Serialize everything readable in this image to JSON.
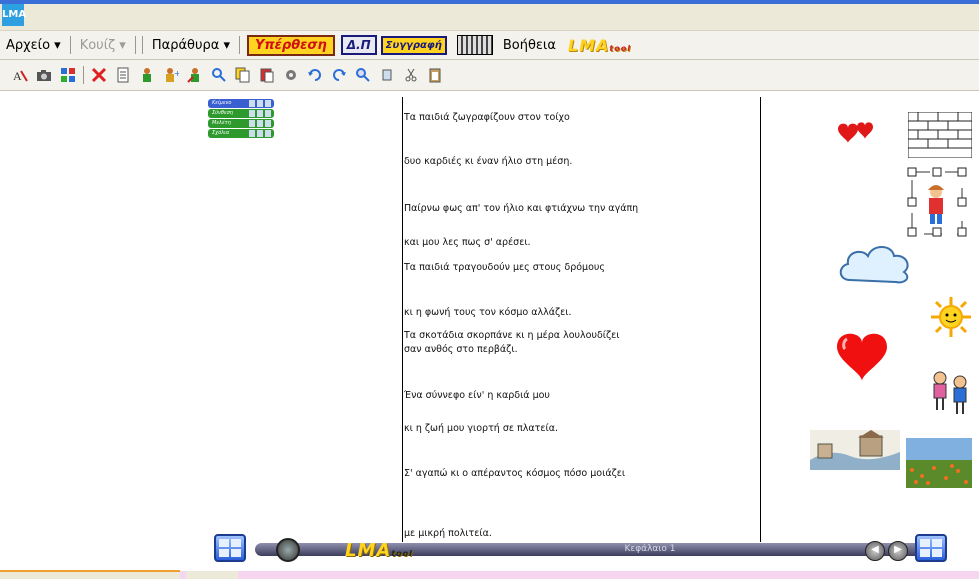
{
  "app": {
    "icon_label": "LMA"
  },
  "menu": {
    "items": [
      {
        "label": "Αρχείο ▾",
        "enabled": true
      },
      {
        "label": "Κουίζ ▾",
        "enabled": false
      },
      {
        "label": "Παράθυρα ▾",
        "enabled": true
      }
    ],
    "overview_button": "Υπέρθεση",
    "dp_button": "Δ.Π",
    "writing_button": "Συγγραφή",
    "help": "Βοήθεια",
    "logo_text": "LMA",
    "logo_sub": "tool"
  },
  "toolbar": {
    "icons": [
      "font-icon",
      "camera-icon",
      "grid-icon",
      "delete-icon",
      "page-icon",
      "person-icon",
      "person-add-icon",
      "person-edit-icon",
      "search-person-icon",
      "copy-icon",
      "paste-icon",
      "settings-icon",
      "undo-icon",
      "redo-icon",
      "zoom-icon",
      "small-page-icon",
      "scissors-icon",
      "clipboard-icon"
    ]
  },
  "mini_panel": {
    "rows": [
      {
        "label": "Κείμενο",
        "color": "#3a5fd0"
      },
      {
        "label": "Σύνθεση",
        "color": "#2e9a2e"
      },
      {
        "label": "Μελέτη",
        "color": "#2e9a2e"
      },
      {
        "label": "Σχόλια",
        "color": "#2e9a2e"
      }
    ]
  },
  "document": {
    "lines": [
      "Τα παιδιά ζωγραφίζουν στον τοίχο",
      "δυο καρδιές κι έναν ήλιο στη μέση.",
      "Παίρνω φως απ' τον ήλιο και φτιάχνω την αγάπη",
      "και μου λες πως σ' αρέσει.",
      "Τα παιδιά τραγουδούν μες στους δρόμους",
      "κι η φωνή τους τον κόσμο αλλάζει.",
      "Τα σκοτάδια σκορπάνε κι η μέρα λουλουδίζει",
      "σαν ανθός στο περβάζι.",
      "Ένα σύννεφο είν' η καρδιά μου",
      "κι η ζωή μου γιορτή σε πλατεία.",
      "Σ' αγαπώ κι ο απέραντος κόσμος πόσο μοιάζει",
      "με μικρή πολιτεία."
    ]
  },
  "clipart": {
    "items": [
      "hearts",
      "wall",
      "children-painting",
      "cloud",
      "sun",
      "big-heart",
      "kids-singing",
      "city-sketch",
      "flower-field"
    ]
  },
  "navigation": {
    "chapter": "Κεφάλαιο 1",
    "logo_text": "LMA",
    "logo_sub": "tool"
  }
}
